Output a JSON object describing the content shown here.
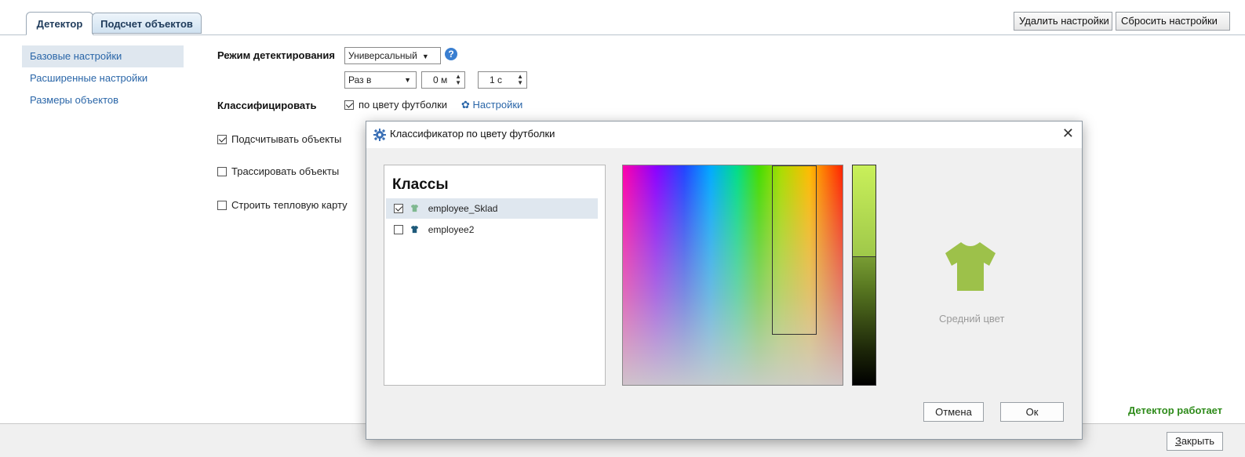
{
  "tabs": [
    {
      "label": "Детектор",
      "active": true
    },
    {
      "label": "Подсчет объектов",
      "active": false
    }
  ],
  "toolbar": {
    "delete_label": "Удалить настройки",
    "reset_label": "Сбросить настройки"
  },
  "sidebar": {
    "items": [
      {
        "label": "Базовые настройки",
        "selected": true
      },
      {
        "label": "Расширенные настройки",
        "selected": false
      },
      {
        "label": "Размеры объектов",
        "selected": false
      }
    ]
  },
  "settings": {
    "mode_label": "Режим детектирования",
    "mode_value": "Универсальный",
    "interval_value": "Раз в",
    "minutes_value": "0 м",
    "seconds_value": "1 с",
    "classify_label": "Классифицировать",
    "classify_option": "по цвету футболки",
    "classify_option_checked": true,
    "classify_settings_link": "Настройки",
    "count_objects": "Подсчитывать объекты",
    "count_objects_checked": true,
    "trace_objects": "Трассировать объекты",
    "trace_objects_checked": false,
    "heatmap": "Строить тепловую карту",
    "heatmap_checked": false
  },
  "status": {
    "text": "Детектор работает",
    "color": "#2e8b1a"
  },
  "footer": {
    "close_label": "Закрыть"
  },
  "dialog": {
    "title": "Классификатор по цвету футболки",
    "classes_title": "Классы",
    "classes": [
      {
        "name": "employee_Sklad",
        "checked": true,
        "color": "#7fb890",
        "selected": true
      },
      {
        "name": "employee2",
        "checked": false,
        "color": "#1e5a7a",
        "selected": false
      }
    ],
    "average_color_label": "Средний цвет",
    "average_color": "#9dc14a",
    "cancel_label": "Отмена",
    "ok_label": "Ок"
  }
}
